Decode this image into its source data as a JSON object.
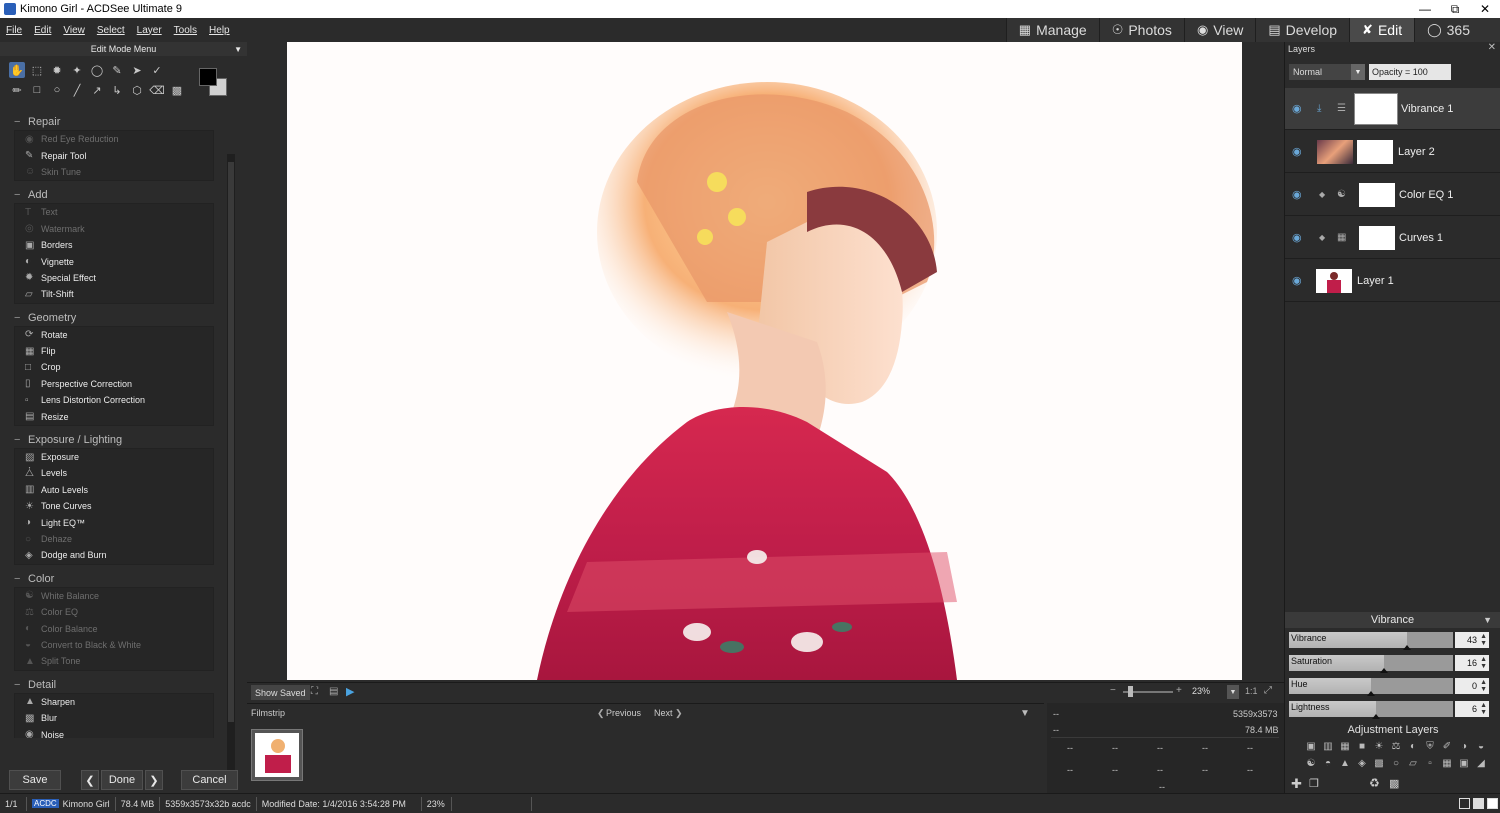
{
  "window": {
    "title": "Kimono Girl - ACDSee Ultimate 9"
  },
  "menubar": [
    "File",
    "Edit",
    "View",
    "Select",
    "Layer",
    "Tools",
    "Help"
  ],
  "modes": [
    {
      "label": "Manage",
      "icon": "grid-icon"
    },
    {
      "label": "Photos",
      "icon": "photos-icon"
    },
    {
      "label": "View",
      "icon": "eye-icon"
    },
    {
      "label": "Develop",
      "icon": "develop-icon"
    },
    {
      "label": "Edit",
      "icon": "edit-icon",
      "active": true
    },
    {
      "label": "365",
      "icon": "365-icon"
    }
  ],
  "edit_menu": {
    "title": "Edit Mode Menu",
    "sections": [
      {
        "title": "Repair",
        "items": [
          {
            "label": "Red Eye Reduction",
            "disabled": true
          },
          {
            "label": "Repair Tool",
            "disabled": false
          },
          {
            "label": "Skin Tune",
            "disabled": true
          }
        ]
      },
      {
        "title": "Add",
        "items": [
          {
            "label": "Text",
            "disabled": true
          },
          {
            "label": "Watermark",
            "disabled": true
          },
          {
            "label": "Borders",
            "disabled": false
          },
          {
            "label": "Vignette",
            "disabled": false
          },
          {
            "label": "Special Effect",
            "disabled": false
          },
          {
            "label": "Tilt-Shift",
            "disabled": false
          }
        ]
      },
      {
        "title": "Geometry",
        "items": [
          {
            "label": "Rotate",
            "disabled": false
          },
          {
            "label": "Flip",
            "disabled": false
          },
          {
            "label": "Crop",
            "disabled": false
          },
          {
            "label": "Perspective Correction",
            "disabled": false
          },
          {
            "label": "Lens Distortion Correction",
            "disabled": false
          },
          {
            "label": "Resize",
            "disabled": false
          }
        ]
      },
      {
        "title": "Exposure / Lighting",
        "items": [
          {
            "label": "Exposure",
            "disabled": false
          },
          {
            "label": "Levels",
            "disabled": false
          },
          {
            "label": "Auto Levels",
            "disabled": false
          },
          {
            "label": "Tone Curves",
            "disabled": false
          },
          {
            "label": "Light EQ™",
            "disabled": false
          },
          {
            "label": "Dehaze",
            "disabled": true
          },
          {
            "label": "Dodge and Burn",
            "disabled": false
          }
        ]
      },
      {
        "title": "Color",
        "items": [
          {
            "label": "White Balance",
            "disabled": true
          },
          {
            "label": "Color EQ",
            "disabled": true
          },
          {
            "label": "Color Balance",
            "disabled": true
          },
          {
            "label": "Convert to Black & White",
            "disabled": true
          },
          {
            "label": "Split Tone",
            "disabled": true
          }
        ]
      },
      {
        "title": "Detail",
        "items": [
          {
            "label": "Sharpen",
            "disabled": false
          },
          {
            "label": "Blur",
            "disabled": false
          },
          {
            "label": "Noise",
            "disabled": false
          }
        ]
      }
    ]
  },
  "bottom_buttons": {
    "save": "Save",
    "done": "Done",
    "cancel": "Cancel"
  },
  "viewer": {
    "show_saved": "Show Saved",
    "zoom": "23%",
    "ratio": "1:1"
  },
  "filmstrip": {
    "title": "Filmstrip",
    "previous": "Previous",
    "next": "Next"
  },
  "info": {
    "dimensions": "5359x3573",
    "size": "78.4 MB",
    "placeholder": "--"
  },
  "layers_panel": {
    "title": "Layers",
    "blend_mode": "Normal",
    "opacity": "Opacity = 100",
    "layers": [
      {
        "name": "Vibrance  1",
        "selected": true
      },
      {
        "name": "Layer 2",
        "selected": false
      },
      {
        "name": "Color EQ  1",
        "selected": false
      },
      {
        "name": "Curves  1",
        "selected": false
      },
      {
        "name": "Layer 1",
        "selected": false
      }
    ]
  },
  "vibrance_panel": {
    "title": "Vibrance",
    "sliders": [
      {
        "label": "Vibrance",
        "value": "43",
        "fraction": 0.72
      },
      {
        "label": "Saturation",
        "value": "16",
        "fraction": 0.58
      },
      {
        "label": "Hue",
        "value": "0",
        "fraction": 0.5
      },
      {
        "label": "Lightness",
        "value": "6",
        "fraction": 0.53
      }
    ],
    "adjustment_layers_title": "Adjustment Layers"
  },
  "statusbar": {
    "index": "1/1",
    "format": "ACDC",
    "filename": "Kimono Girl",
    "filesize": "78.4 MB",
    "dims": "5359x3573x32b acdc",
    "modified": "Modified Date: 1/4/2016 3:54:28 PM",
    "zoom": "23%"
  }
}
